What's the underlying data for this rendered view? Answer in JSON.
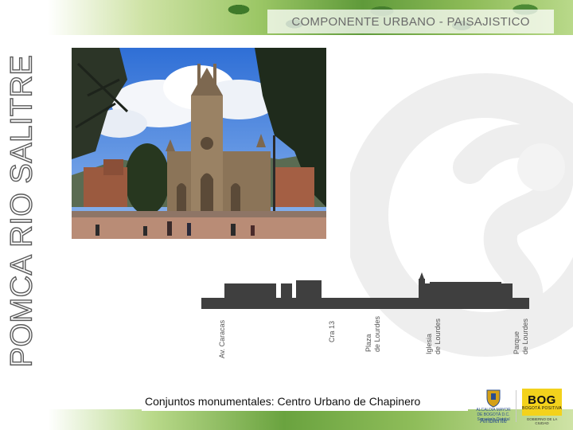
{
  "slide": {
    "side_title": "POMCA RIO SALITRE",
    "header_label": "COMPONENTE URBANO - PAISAJISTICO",
    "caption": "Conjuntos monumentales: Centro Urbano de Chapinero"
  },
  "profile": {
    "labels": [
      "Av. Caracas",
      "Cra 13",
      "Plaza de Lourdes",
      "Iglesia de Lourdes",
      "Parque de Lourdes"
    ],
    "color": "#3f3f3f"
  },
  "logos": {
    "ambiente_text": "ALCALDÍA MAYOR DE BOGOTÁ D.C. Secretaría Distrital",
    "ambiente_name": "Ambiente",
    "bog_word": "BOG",
    "bog_sub": "BOGOTÁ POSITIVA",
    "bog_foot": "GOBIERNO DE LA CIUDAD"
  },
  "colors": {
    "accent_green": "#5f9a3a",
    "logo_yellow": "#f3d21c",
    "logo_blue": "#2a4d8f"
  }
}
